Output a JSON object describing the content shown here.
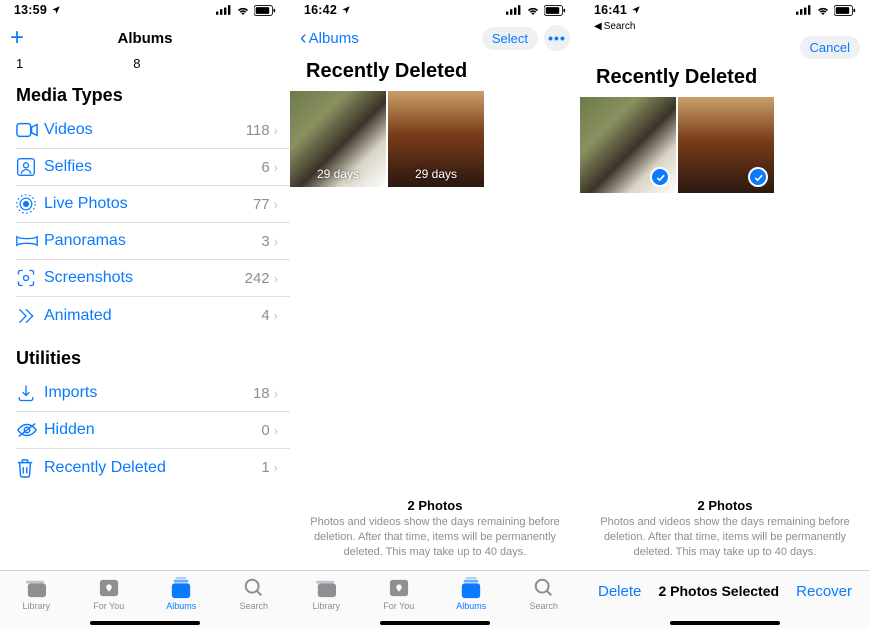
{
  "screen1": {
    "status_time": "13:59",
    "nav_title": "Albums",
    "truncated_left": "1",
    "truncated_right": "8",
    "media_types_header": "Media Types",
    "media_types": [
      {
        "label": "Videos",
        "count": "118"
      },
      {
        "label": "Selfies",
        "count": "6"
      },
      {
        "label": "Live Photos",
        "count": "77"
      },
      {
        "label": "Panoramas",
        "count": "3"
      },
      {
        "label": "Screenshots",
        "count": "242"
      },
      {
        "label": "Animated",
        "count": "4"
      }
    ],
    "utilities_header": "Utilities",
    "utilities": [
      {
        "label": "Imports",
        "count": "18"
      },
      {
        "label": "Hidden",
        "count": "0"
      },
      {
        "label": "Recently Deleted",
        "count": "1"
      }
    ]
  },
  "screen2": {
    "status_time": "16:42",
    "back_label": "Albums",
    "select_label": "Select",
    "title": "Recently Deleted",
    "thumbs": [
      {
        "days": "29 days"
      },
      {
        "days": "29 days"
      }
    ],
    "info_title": "2 Photos",
    "info_sub": "Photos and videos show the days remaining before deletion. After that time, items will be permanently deleted. This may take up to 40 days."
  },
  "screen3": {
    "status_time": "16:41",
    "back_search": "Search",
    "cancel_label": "Cancel",
    "title": "Recently Deleted",
    "info_title": "2 Photos",
    "info_sub": "Photos and videos show the days remaining before deletion. After that time, items will be permanently deleted. This may take up to 40 days.",
    "delete_label": "Delete",
    "selected_label": "2 Photos Selected",
    "recover_label": "Recover"
  },
  "tabs": [
    {
      "label": "Library"
    },
    {
      "label": "For You"
    },
    {
      "label": "Albums"
    },
    {
      "label": "Search"
    }
  ]
}
